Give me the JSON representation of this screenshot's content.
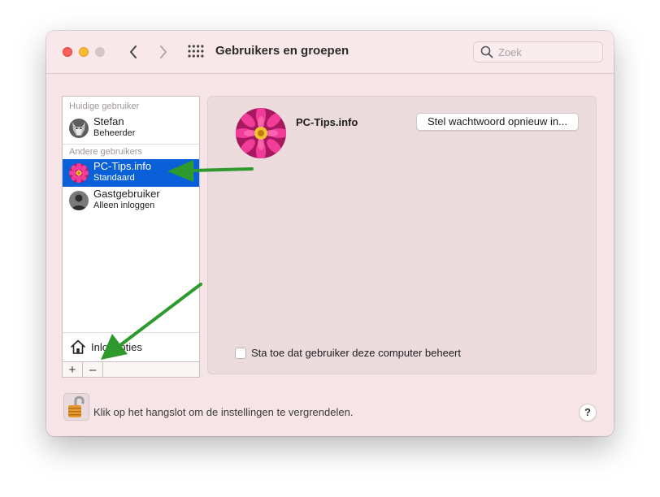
{
  "window": {
    "title": "Gebruikers en groepen"
  },
  "toolbar": {
    "back_icon": "chevron-left-icon",
    "forward_icon": "chevron-right-icon",
    "grid_icon": "show-all-grid-icon"
  },
  "search": {
    "placeholder": "Zoek",
    "value": ""
  },
  "sidebar": {
    "current_users_header": "Huidige gebruiker",
    "other_users_header": "Andere gebruikers",
    "users": [
      {
        "name": "Stefan",
        "role": "Beheerder",
        "avatar": "wolf-avatar",
        "selected": false
      },
      {
        "name": "PC-Tips.info",
        "role": "Standaard",
        "avatar": "pink-flower-avatar",
        "selected": true
      },
      {
        "name": "Gastgebruiker",
        "role": "Alleen inloggen",
        "avatar": "guest-silhouette-avatar",
        "selected": false
      }
    ],
    "login_options_label": "Inlogopties",
    "add_label": "+",
    "remove_label": "–"
  },
  "detail": {
    "user_name": "PC-Tips.info",
    "reset_password_label": "Stel wachtwoord opnieuw in...",
    "allow_admin_label": "Sta toe dat gebruiker deze computer beheert",
    "allow_admin_checked": false
  },
  "footer": {
    "lock_text": "Klik op het hangslot om de instellingen te vergrendelen.",
    "help_label": "?"
  },
  "annotations": {
    "arrow_color": "#2e9a2e"
  },
  "colors": {
    "selection": "#0a60d8",
    "window_bg": "#f6e4e6",
    "close": "#fe5f57",
    "minimize": "#febc2e"
  }
}
